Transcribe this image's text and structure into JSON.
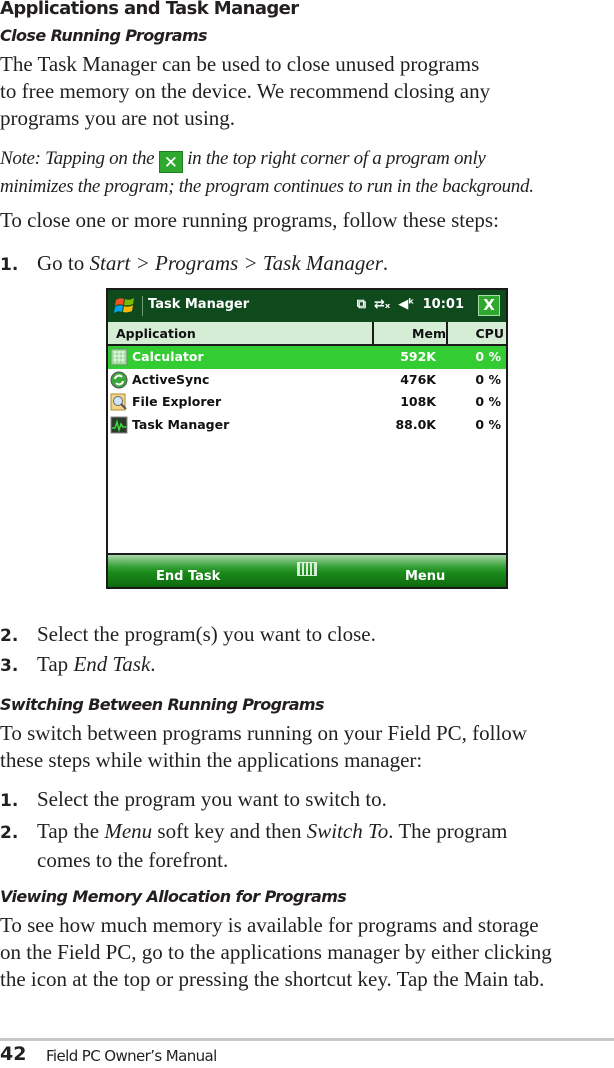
{
  "heading": "Applications and Task Manager",
  "sections": {
    "close": {
      "title": "Close Running Programs",
      "intro_lines": [
        "The Task Manager can be used to close unused programs",
        "to free memory on the device. We recommend closing any",
        "programs you are not using."
      ],
      "note_prefix": "Note: Tapping on the",
      "note_icon": "close-x-icon",
      "note_suffix": "in the top right corner of a program only",
      "note_line2": "minimizes the program; the program continues to run in the background.",
      "steps_intro": "To close one or more running programs, follow these steps:",
      "steps": [
        {
          "num": "1.",
          "pre": "Go to ",
          "em": "Start > Programs > Task Manager",
          "post": "."
        },
        {
          "num": "2.",
          "pre": "Select the program(s) you want to close.",
          "em": "",
          "post": ""
        },
        {
          "num": "3.",
          "pre": "Tap ",
          "em": "End Task",
          "post": "."
        }
      ]
    },
    "switch": {
      "title": "Switching Between Running Programs",
      "intro_lines": [
        "To switch between programs running on your Field PC, follow",
        "these steps while within the applications manager:"
      ],
      "steps": [
        {
          "num": "1.",
          "text": "Select the program you want to switch to."
        },
        {
          "num": "2.",
          "pre": "Tap the ",
          "em1": "Menu",
          "mid": " soft key and then ",
          "em2": "Switch To",
          "post": ". The program",
          "line2": "comes to the forefront."
        }
      ]
    },
    "memory": {
      "title": "Viewing Memory Allocation for Programs",
      "lines": [
        "To see how much memory is available for programs and storage",
        "on the Field PC, go to the applications manager by either clicking",
        "the icon at the top or pressing the shortcut key. Tap the Main tab."
      ]
    }
  },
  "device": {
    "title": "Task Manager",
    "time": "10:01",
    "status_icons": [
      "connectivity-icon",
      "network-x-icon",
      "speaker-muted-icon"
    ],
    "close_label": "X",
    "columns": {
      "application": "Application",
      "mem": "Mem",
      "cpu": "CPU"
    },
    "rows": [
      {
        "name": "Calculator",
        "mem": "592K",
        "cpu": "0 %",
        "selected": true,
        "icon": "calculator-icon"
      },
      {
        "name": "ActiveSync",
        "mem": "476K",
        "cpu": "0 %",
        "selected": false,
        "icon": "activesync-icon"
      },
      {
        "name": "File Explorer",
        "mem": "108K",
        "cpu": "0 %",
        "selected": false,
        "icon": "file-explorer-icon"
      },
      {
        "name": "Task Manager",
        "mem": "88.0K",
        "cpu": "0 %",
        "selected": false,
        "icon": "task-manager-icon"
      }
    ],
    "softkeys": {
      "left": "End Task",
      "right": "Menu"
    },
    "colors": {
      "titlebar": "#0f4a1d",
      "selected_row": "#33cc33",
      "header": "#d5ecd5"
    }
  },
  "footer": {
    "page_number": "42",
    "text": "Field PC Owner’s Manual"
  }
}
